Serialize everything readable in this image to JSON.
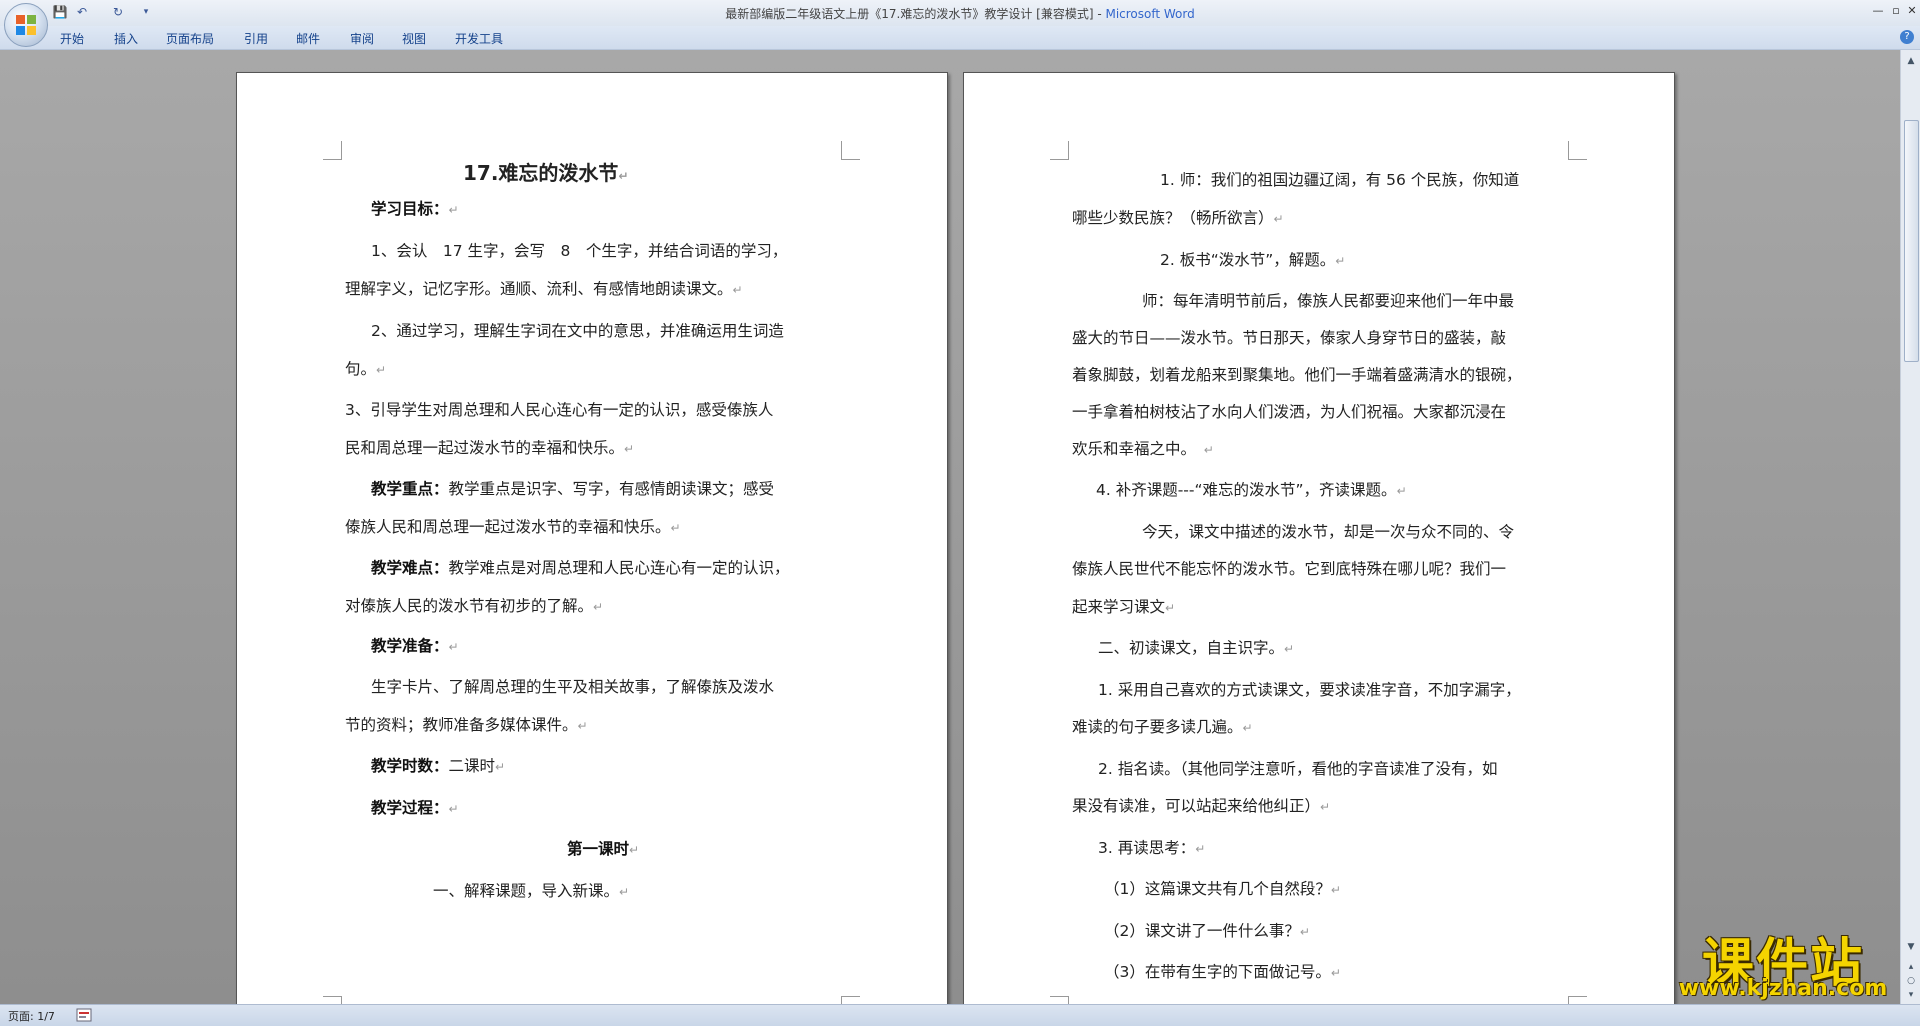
{
  "titlebar": {
    "document_title": "最新部编版二年级语文上册《17.难忘的泼水节》教学设计 [兼容模式] - ",
    "app_name": "Microsoft Word",
    "minimize": "—",
    "maximize": "▫",
    "close": "✕"
  },
  "quick_access": {
    "save": "💾",
    "undo": "↶",
    "redo": "↻",
    "more": "▾"
  },
  "ribbon": {
    "tabs": [
      "开始",
      "插入",
      "页面布局",
      "引用",
      "邮件",
      "审阅",
      "视图",
      "开发工具"
    ],
    "help": "?"
  },
  "page1": {
    "title": "17.难忘的泼水节",
    "lines": [
      {
        "b": "学习目标：",
        "t": ""
      },
      {
        "b": "",
        "t": "1、会认　17 生字，会写　8　个生字，并结合词语的学习，"
      },
      {
        "b": "",
        "t": "理解字义，记忆字形。通顺、流利、有感情地朗读课文。"
      },
      {
        "b": "",
        "t": "2、通过学习，理解生字词在文中的意思，并准确运用生词造"
      },
      {
        "b": "",
        "t": "句。"
      },
      {
        "b": "",
        "t": "3、引导学生对周总理和人民心连心有一定的认识，感受傣族人"
      },
      {
        "b": "",
        "t": "民和周总理一起过泼水节的幸福和快乐。"
      },
      {
        "b": "教学重点：",
        "t": "教学重点是识字、写字，有感情朗读课文；感受"
      },
      {
        "b": "",
        "t": "傣族人民和周总理一起过泼水节的幸福和快乐。"
      },
      {
        "b": "教学难点：",
        "t": "教学难点是对周总理和人民心连心有一定的认识，"
      },
      {
        "b": "",
        "t": "对傣族人民的泼水节有初步的了解。"
      },
      {
        "b": "教学准备：",
        "t": ""
      },
      {
        "b": "",
        "t": "生字卡片、了解周总理的生平及相关故事，了解傣族及泼水"
      },
      {
        "b": "",
        "t": "节的资料；教师准备多媒体课件。"
      },
      {
        "b": "教学时数：",
        "t": "二课时"
      },
      {
        "b": "教学过程：",
        "t": ""
      },
      {
        "b": "第一课时",
        "t": ""
      },
      {
        "b": "",
        "t": "一、解释课题，导入新课。"
      }
    ]
  },
  "page2": {
    "lines": [
      "1. 师：我们的祖国边疆辽阔，有 56 个民族，你知道",
      "哪些少数民族？（畅所欲言）",
      "2. 板书“泼水节”，解题。",
      "师：每年清明节前后，傣族人民都要迎来他们一年中最",
      "盛大的节日——泼水节。节日那天，傣家人身穿节日的盛装，敲",
      "着象脚鼓，划着龙船来到聚集地。他们一手端着盛满清水的银碗，",
      "一手拿着柏树枝沾了水向人们泼洒，为人们祝福。大家都沉浸在",
      "欢乐和幸福之中。",
      "4. 补齐课题---“难忘的泼水节”，齐读课题。",
      "今天，课文中描述的泼水节，却是一次与众不同的、令",
      "傣族人民世代不能忘怀的泼水节。它到底特殊在哪儿呢？我们一",
      "起来学习课文",
      "二、初读课文，自主识字。",
      "1. 采用自己喜欢的方式读课文，要求读准字音，不加字漏字，",
      "难读的句子要多读几遍。",
      "2. 指名读。（其他同学注意听，看他的字音读准了没有，如",
      "果没有读准，可以站起来给他纠正）",
      "3. 再读思考：",
      "（1）这篇课文共有几个自然段？",
      "（2）课文讲了一件什么事？",
      "（3）在带有生字的下面做记号。"
    ]
  },
  "paragraph_mark": "↵",
  "statusbar": {
    "page_info": "页面: 1/7"
  },
  "watermark": {
    "main": "课件站",
    "url": "www.kjzhan.com"
  },
  "colors": {
    "brand": "#3366cc",
    "ribbon_text": "#15428b",
    "watermark": "#f4d400"
  }
}
